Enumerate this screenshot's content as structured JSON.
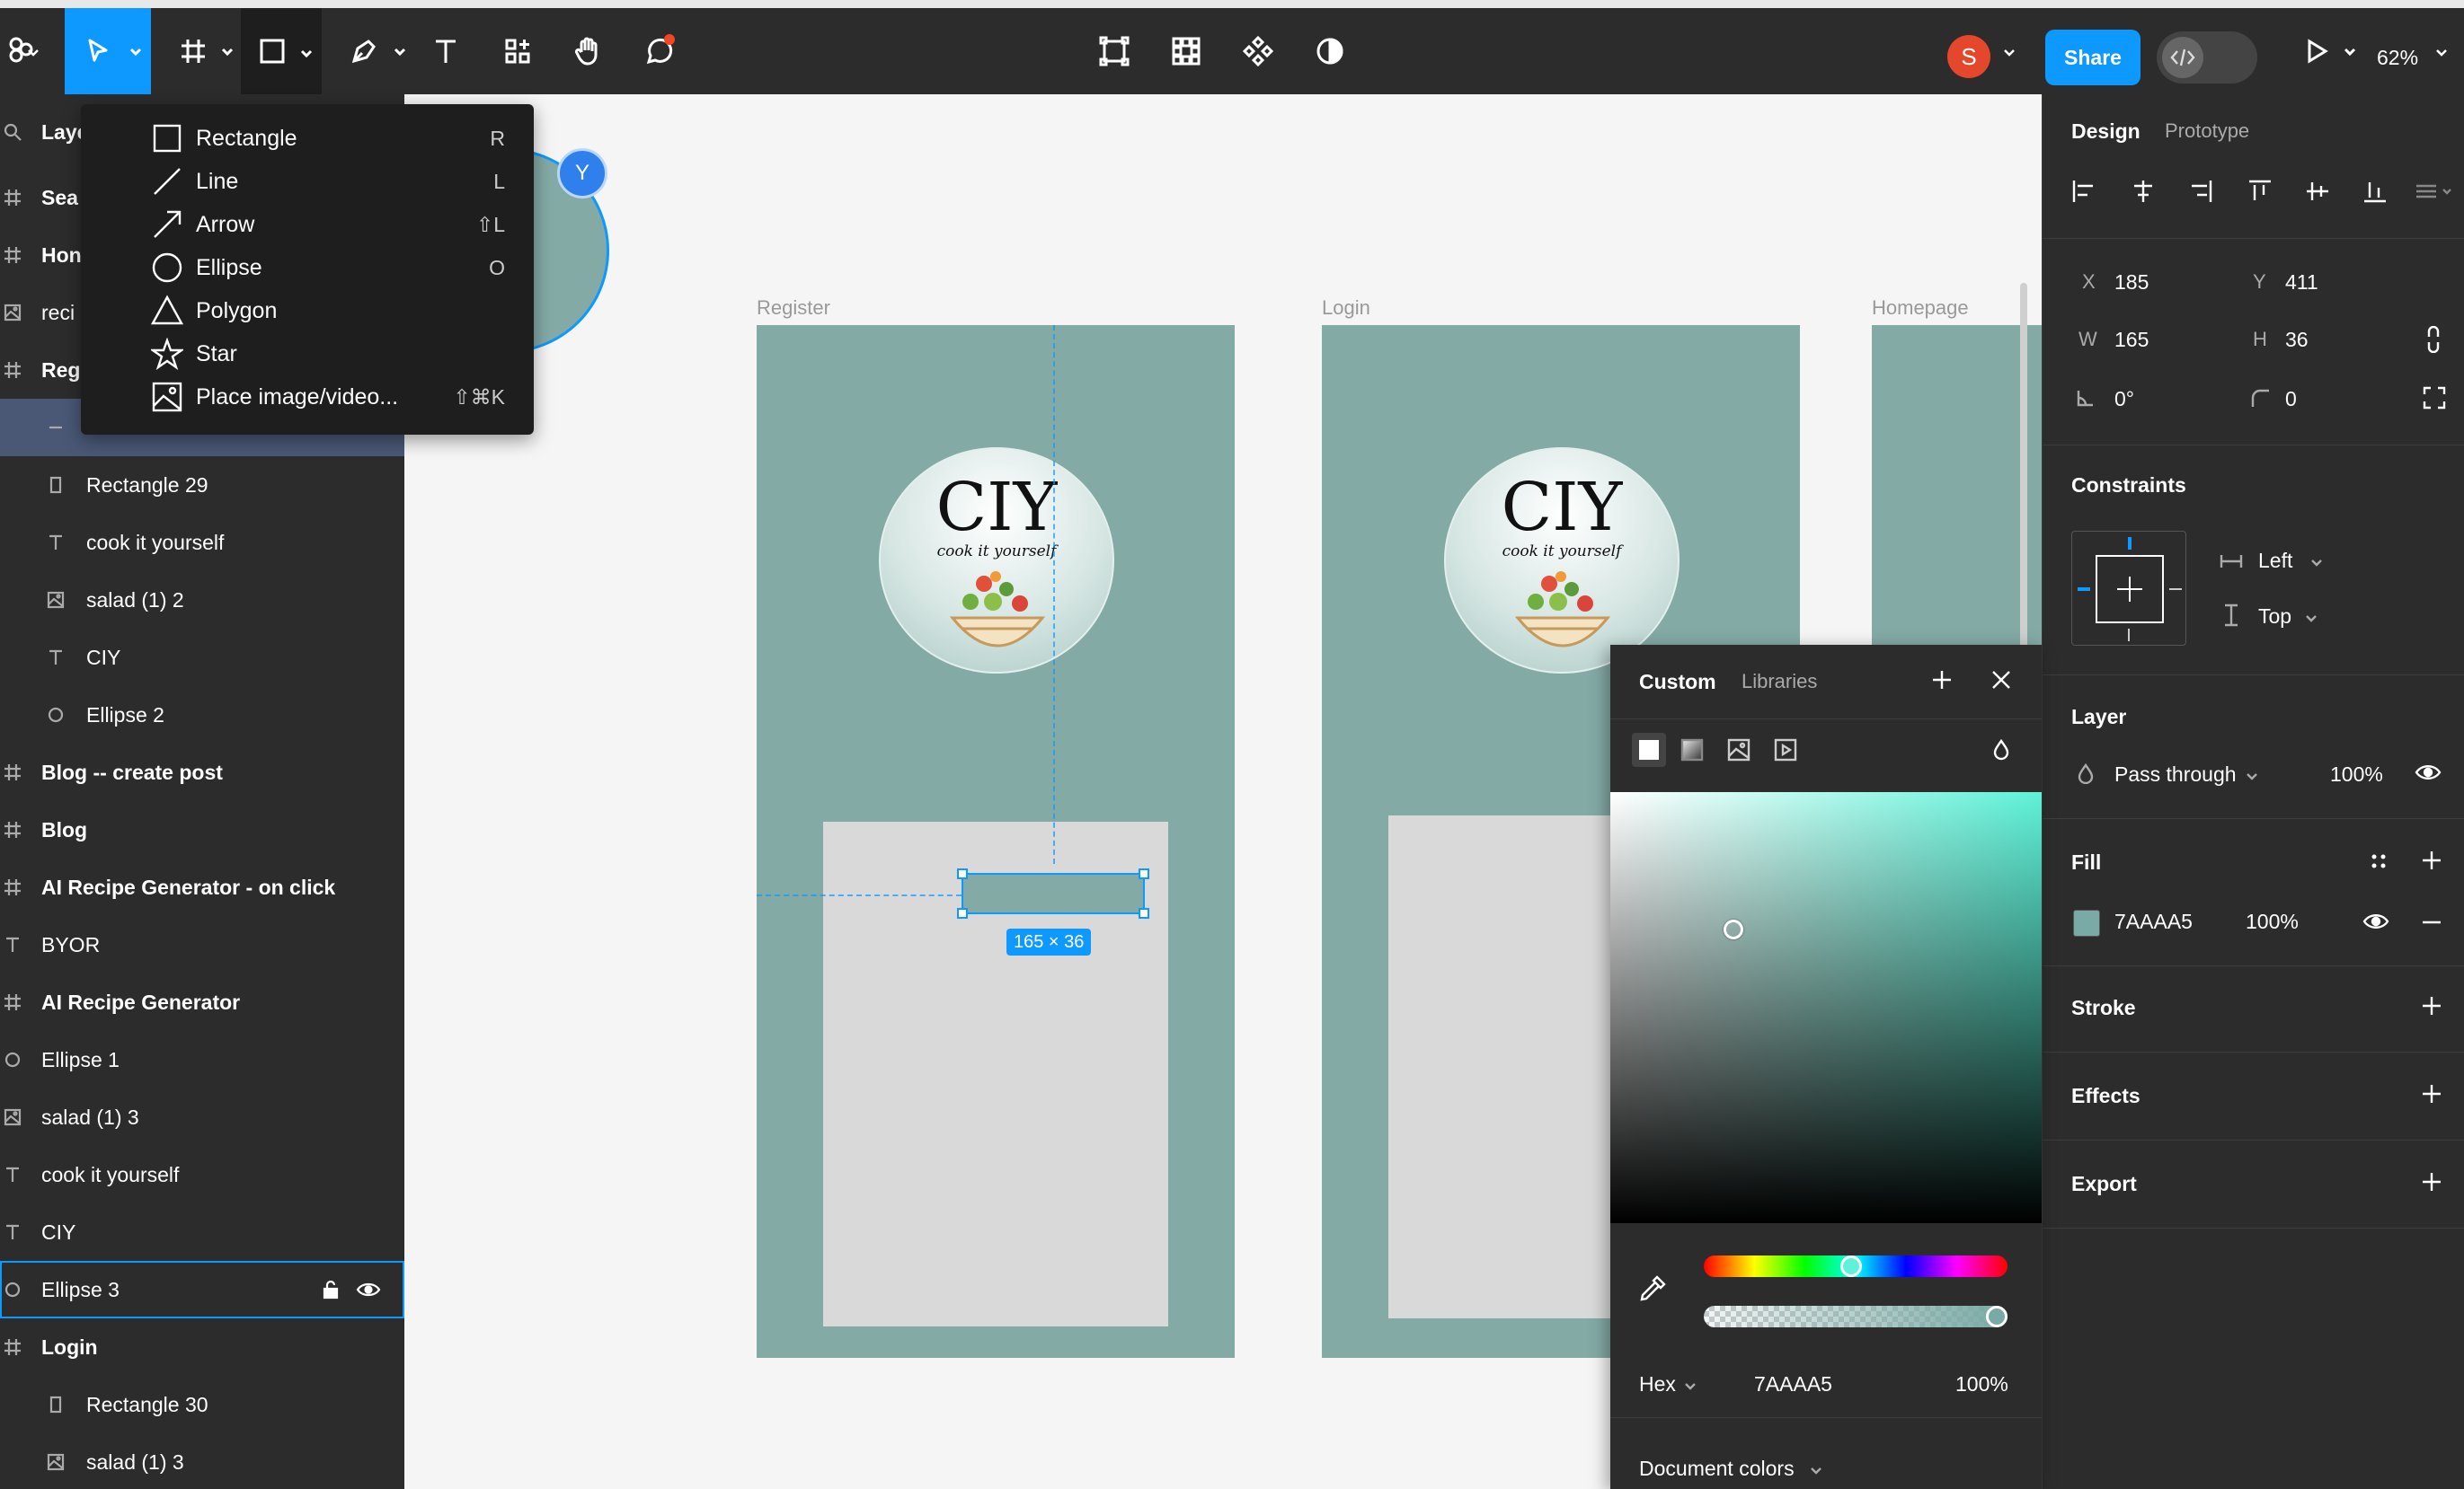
{
  "toolbar": {
    "share_label": "Share",
    "user_initial": "S",
    "zoom_label": "62%",
    "accent_color": "#0d99ff"
  },
  "shape_menu": {
    "items": [
      {
        "label": "Rectangle",
        "shortcut": "R",
        "icon": "rectangle-icon"
      },
      {
        "label": "Line",
        "shortcut": "L",
        "icon": "line-icon"
      },
      {
        "label": "Arrow",
        "shortcut": "⇧L",
        "icon": "arrow-icon"
      },
      {
        "label": "Ellipse",
        "shortcut": "O",
        "icon": "ellipse-icon"
      },
      {
        "label": "Polygon",
        "shortcut": "",
        "icon": "polygon-icon"
      },
      {
        "label": "Star",
        "shortcut": "",
        "icon": "star-icon"
      },
      {
        "label": "Place image/video...",
        "shortcut": "⇧⌘K",
        "icon": "image-icon"
      }
    ]
  },
  "layers": {
    "header_label": "Laye",
    "items": [
      {
        "label": "Sea",
        "type": "frame"
      },
      {
        "label": "Hon",
        "type": "frame"
      },
      {
        "label": "reci",
        "type": "image"
      },
      {
        "label": "Reg",
        "type": "frame"
      },
      {
        "label": "",
        "type": "rectangle"
      },
      {
        "label": "Rectangle 29",
        "type": "rectangle"
      },
      {
        "label": "cook it yourself",
        "type": "text"
      },
      {
        "label": "salad (1) 2",
        "type": "image"
      },
      {
        "label": "CIY",
        "type": "text"
      },
      {
        "label": "Ellipse 2",
        "type": "ellipse"
      },
      {
        "label": "Blog -- create post",
        "type": "frame"
      },
      {
        "label": "Blog",
        "type": "frame"
      },
      {
        "label": "AI Recipe Generator - on click",
        "type": "frame"
      },
      {
        "label": "BYOR",
        "type": "text"
      },
      {
        "label": "AI Recipe Generator",
        "type": "frame"
      },
      {
        "label": "Ellipse 1",
        "type": "ellipse"
      },
      {
        "label": "salad (1) 3",
        "type": "image"
      },
      {
        "label": "cook it yourself",
        "type": "text"
      },
      {
        "label": "CIY",
        "type": "text"
      },
      {
        "label": "Ellipse 3",
        "type": "ellipse"
      },
      {
        "label": "Login",
        "type": "frame"
      },
      {
        "label": "Rectangle 30",
        "type": "rectangle"
      },
      {
        "label": "salad (1) 3",
        "type": "image"
      }
    ]
  },
  "canvas": {
    "cursor_label": "Y",
    "frames": [
      {
        "label": "Register"
      },
      {
        "label": "Login"
      },
      {
        "label": "Homepage"
      }
    ],
    "logo_title": "CIY",
    "logo_subtitle": "cook it yourself",
    "frame_color": "#84aaa6",
    "selection_size": "165 × 36"
  },
  "design_panel": {
    "tabs": [
      "Design",
      "Prototype"
    ],
    "x_label": "X",
    "x_value": "185",
    "y_label": "Y",
    "y_value": "411",
    "w_label": "W",
    "w_value": "165",
    "h_label": "H",
    "h_value": "36",
    "rotation_value": "0°",
    "radius_value": "0",
    "constraints_title": "Constraints",
    "constraint_h": "Left",
    "constraint_v": "Top",
    "layer_title": "Layer",
    "blend_mode": "Pass through",
    "layer_opacity": "100%",
    "fill_title": "Fill",
    "fill_hex": "7AAAA5",
    "fill_opacity": "100%",
    "fill_color": "#7AAAA5",
    "stroke_title": "Stroke",
    "effects_title": "Effects",
    "export_title": "Export"
  },
  "color_picker": {
    "tabs": [
      "Custom",
      "Libraries"
    ],
    "format_label": "Hex",
    "hex_value": "7AAAA5",
    "opacity_value": "100%",
    "doc_colors_label": "Document colors",
    "hue_color": "#5ef2d8"
  }
}
